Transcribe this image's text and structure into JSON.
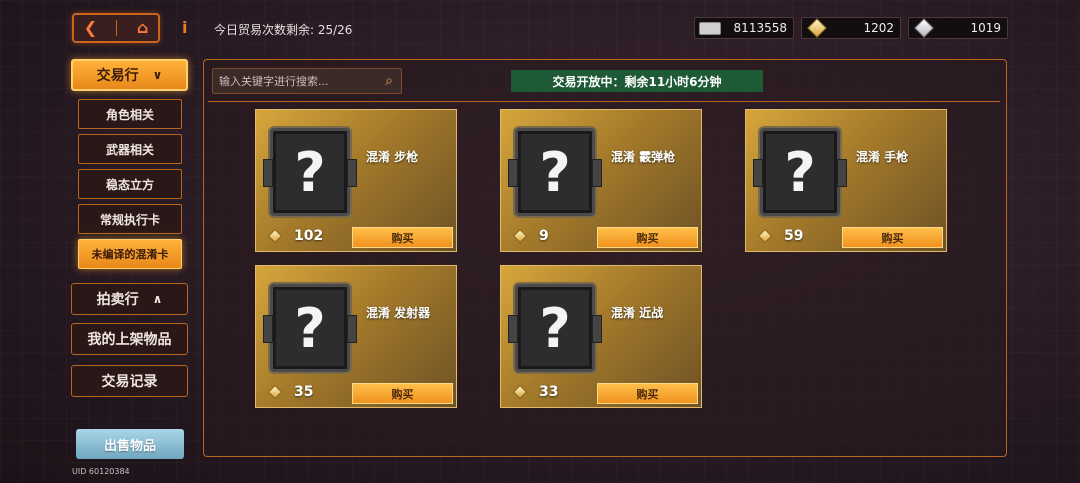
{
  "topbar": {
    "back_icon": "chevron-left-icon",
    "home_icon": "home-icon",
    "info_icon": "info-icon",
    "trade_count_label": "今日贸易次数剩余: 25/26"
  },
  "currencies": {
    "cash": "8113558",
    "gold": "1202",
    "gem": "1019"
  },
  "sidebar": {
    "trade_market": "交易行",
    "sub_items": [
      "角色相关",
      "武器相关",
      "稳态立方",
      "常规执行卡",
      "未编译的混淆卡"
    ],
    "auction": "拍卖行",
    "my_listings": "我的上架物品",
    "trade_records": "交易记录",
    "sell_button": "出售物品",
    "uid": "UID 60120384"
  },
  "search": {
    "placeholder": "输入关键字进行搜索..."
  },
  "status_banner": "交易开放中：剩余11小时6分钟",
  "cards": [
    {
      "name": "混淆 步枪",
      "price": "102",
      "buy_label": "购买"
    },
    {
      "name": "混淆 霰弹枪",
      "price": "9",
      "buy_label": "购买"
    },
    {
      "name": "混淆 手枪",
      "price": "59",
      "buy_label": "购买"
    },
    {
      "name": "混淆 发射器",
      "price": "35",
      "buy_label": "购买"
    },
    {
      "name": "混淆 近战",
      "price": "33",
      "buy_label": "购买"
    }
  ],
  "card_image_glyph": "?",
  "colors": {
    "accent_orange": "#e8881a",
    "border_orange": "#b8651f",
    "status_green": "#1f5a36",
    "sell_blue": "#8cbfd6"
  }
}
